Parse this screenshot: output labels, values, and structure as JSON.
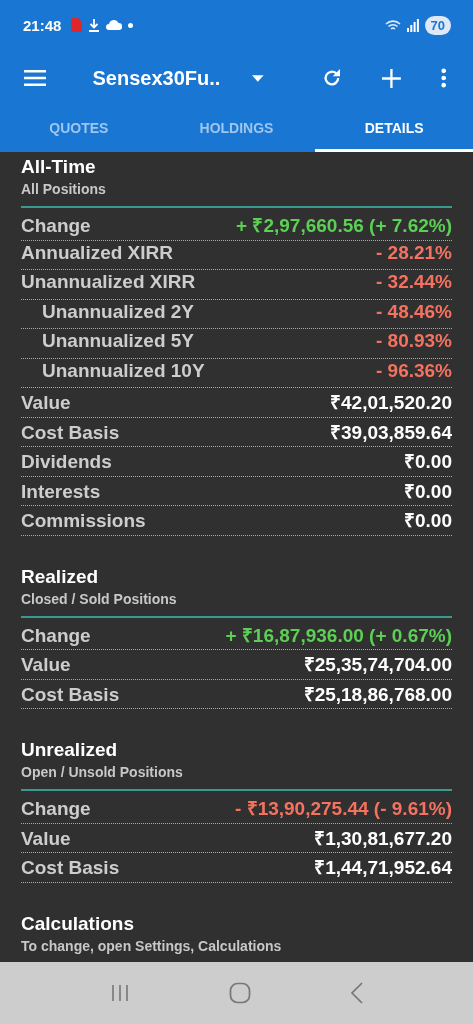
{
  "status_bar": {
    "time": "21:48",
    "battery": "70"
  },
  "toolbar": {
    "title": "Sensex30Fu.."
  },
  "tabs": [
    {
      "label": "QUOTES",
      "selected": false
    },
    {
      "label": "HOLDINGS",
      "selected": false
    },
    {
      "label": "DETAILS",
      "selected": true
    }
  ],
  "sections": [
    {
      "title": "All-Time",
      "subtitle": "All Positions",
      "rows": [
        {
          "label": "Change",
          "value": "+ ₹2,97,660.56 (+ 7.62%)",
          "color": "#5bd054"
        },
        {
          "label": "Annualized XIRR",
          "value": "- 28.21%",
          "color": "#f4725f"
        },
        {
          "label": "Unannualized XIRR",
          "value": "- 32.44%",
          "color": "#f4725f",
          "children": [
            {
              "label": "Unannualized 2Y",
              "value": "- 48.46%",
              "color": "#f4725f"
            },
            {
              "label": "Unannualized 5Y",
              "value": "- 80.93%",
              "color": "#f4725f"
            },
            {
              "label": "Unannualized 10Y",
              "value": "- 96.36%",
              "color": "#f4725f"
            }
          ]
        },
        {
          "label": "Value",
          "value": "₹42,01,520.20",
          "color": "#ffffff"
        },
        {
          "label": "Cost Basis",
          "value": "₹39,03,859.64",
          "color": "#ffffff"
        },
        {
          "label": "Dividends",
          "value": "₹0.00",
          "color": "#ffffff"
        },
        {
          "label": "Interests",
          "value": "₹0.00",
          "color": "#ffffff"
        },
        {
          "label": "Commissions",
          "value": "₹0.00",
          "color": "#ffffff"
        }
      ]
    },
    {
      "title": "Realized",
      "subtitle": "Closed / Sold Positions",
      "rows": [
        {
          "label": "Change",
          "value": "+ ₹16,87,936.00 (+ 0.67%)",
          "color": "#5bd054"
        },
        {
          "label": "Value",
          "value": "₹25,35,74,704.00",
          "color": "#ffffff"
        },
        {
          "label": "Cost Basis",
          "value": "₹25,18,86,768.00",
          "color": "#ffffff"
        }
      ]
    },
    {
      "title": "Unrealized",
      "subtitle": "Open / Unsold Positions",
      "rows": [
        {
          "label": "Change",
          "value": "- ₹13,90,275.44 (- 9.61%)",
          "color": "#f4725f"
        },
        {
          "label": "Value",
          "value": "₹1,30,81,677.20",
          "color": "#ffffff"
        },
        {
          "label": "Cost Basis",
          "value": "₹1,44,71,952.64",
          "color": "#ffffff"
        }
      ]
    },
    {
      "title": "Calculations",
      "subtitle": "To change, open Settings, Calculations"
    }
  ]
}
